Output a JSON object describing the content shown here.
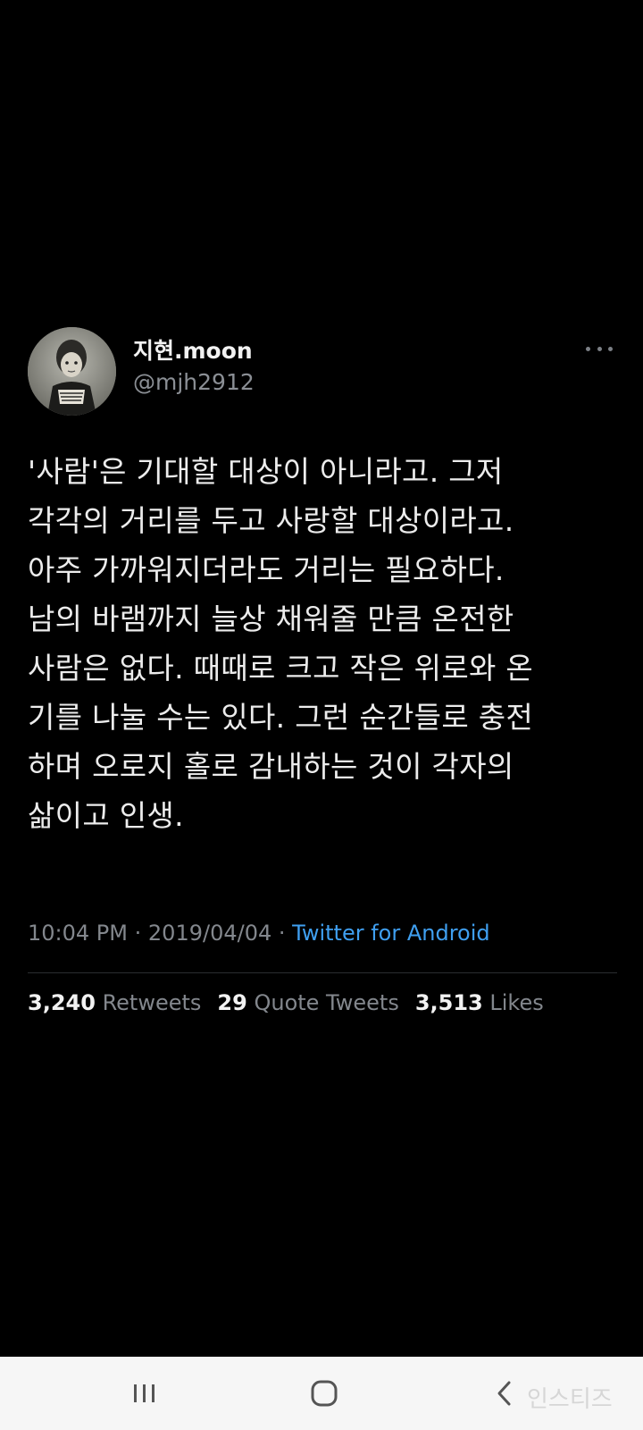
{
  "tweet": {
    "display_name": "지현.moon",
    "handle": "@mjh2912",
    "more_icon": "more-horizontal-icon",
    "body_lines": [
      "'사람'은 기대할 대상이 아니라고. 그저",
      "각각의 거리를 두고 사랑할 대상이라고.",
      "아주 가까워지더라도 거리는 필요하다.",
      "남의 바램까지 늘상 채워줄 만큼 온전한",
      "사람은 없다. 때때로 크고 작은 위로와 온",
      "기를 나눌 수는 있다. 그런 순간들로 충전",
      "하며 오로지 홀로 감내하는 것이 각자의",
      "삶이고 인생."
    ],
    "time": "10:04 PM",
    "separator": "·",
    "date": "2019/04/04",
    "source": "Twitter for Android",
    "stats": {
      "retweets_count": "3,240",
      "retweets_label": "Retweets",
      "quotes_count": "29",
      "quotes_label": "Quote Tweets",
      "likes_count": "3,513",
      "likes_label": "Likes"
    }
  },
  "navbar": {
    "recents_icon": "recent-apps-icon",
    "home_icon": "home-icon",
    "back_icon": "back-icon",
    "watermark": "인스티즈"
  },
  "colors": {
    "background": "#000000",
    "link": "#3f9ff0",
    "secondary_text": "#83878d",
    "navbar_bg": "#f6f6f6"
  }
}
